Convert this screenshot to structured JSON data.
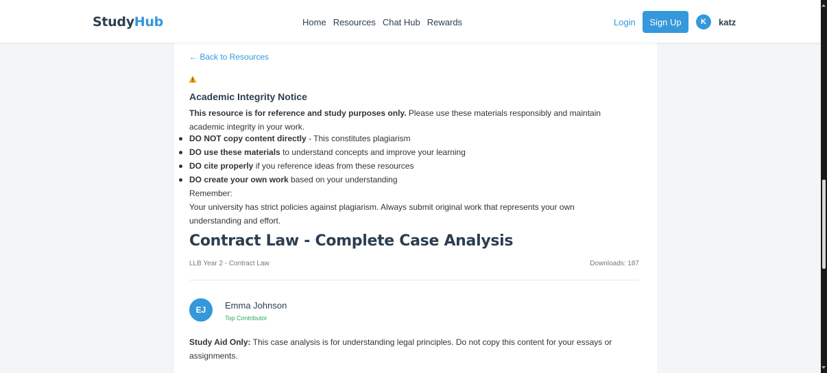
{
  "navbar": {
    "brand_main": "Study",
    "brand_accent": "Hub",
    "links": [
      {
        "label": "Home"
      },
      {
        "label": "Resources"
      },
      {
        "label": "Chat Hub"
      },
      {
        "label": "Rewards"
      }
    ],
    "login_label": "Login",
    "signup_label": "Sign Up",
    "user_initial": "K",
    "user_name": "katz"
  },
  "notice": {
    "back_label": "← Back to Resources",
    "icon": "warning-icon",
    "title": "Academic Integrity Notice",
    "intro_bold": "This resource is for reference and study purposes only.",
    "intro_rest": " Please use these materials responsibly and maintain academic integrity in your work.",
    "items": [
      {
        "bold": "DO NOT copy content directly",
        "rest": " - This constitutes plagiarism"
      },
      {
        "bold": "DO use these materials",
        "rest": " to understand concepts and improve your learning"
      },
      {
        "bold": "DO cite properly",
        "rest": " if you reference ideas from these resources"
      },
      {
        "bold": "DO create your own work",
        "rest": " based on your understanding"
      }
    ],
    "remember_label": "Remember:",
    "remember_text": "Your university has strict policies against plagiarism. Always submit original work that represents your own understanding and effort."
  },
  "resource": {
    "title": "Contract Law - Complete Case Analysis",
    "meta": "LLB Year 2 - Contract Law",
    "downloads": "Downloads: 187",
    "author_initials": "EJ",
    "author_name": "Emma Johnson",
    "author_role": "Top Contributor",
    "study_aid_bold": "Study Aid Only:",
    "study_aid_rest": " This case analysis is for understanding legal principles. Do not copy this content for your essays or assignments."
  },
  "colors": {
    "accent": "#3498db",
    "heading": "#2c3e50",
    "warning": "#f39c12",
    "contributor": "#27ae60"
  }
}
